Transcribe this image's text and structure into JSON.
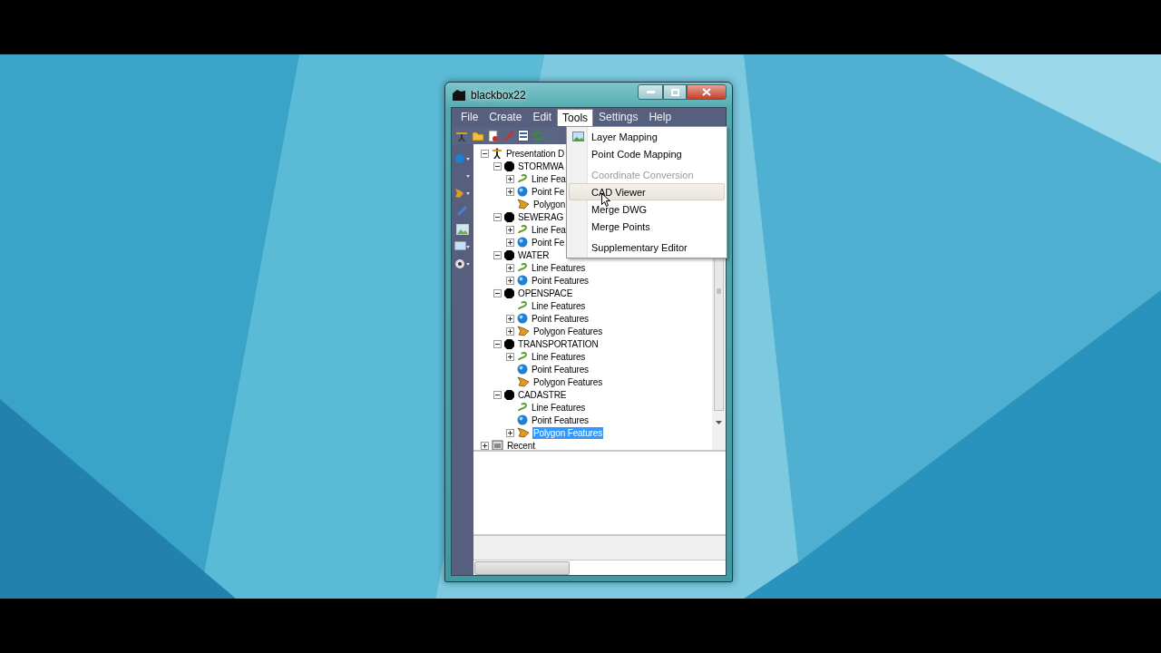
{
  "window": {
    "title": "blackbox22"
  },
  "menu_bar": [
    {
      "label": "File",
      "selected": false
    },
    {
      "label": "Create",
      "selected": false
    },
    {
      "label": "Edit",
      "selected": false
    },
    {
      "label": "Tools",
      "selected": true
    },
    {
      "label": "Settings",
      "selected": false
    },
    {
      "label": "Help",
      "selected": false
    }
  ],
  "tools_menu": [
    {
      "kind": "item",
      "label": "Layer Mapping",
      "icon": true,
      "disabled": false,
      "highlighted": false
    },
    {
      "kind": "item",
      "label": "Point Code Mapping",
      "icon": false,
      "disabled": false,
      "highlighted": false
    },
    {
      "kind": "separator"
    },
    {
      "kind": "item",
      "label": "Coordinate Conversion",
      "icon": false,
      "disabled": true,
      "highlighted": false
    },
    {
      "kind": "item",
      "label": "CAD Viewer",
      "icon": false,
      "disabled": false,
      "highlighted": true
    },
    {
      "kind": "item",
      "label": "Merge DWG",
      "icon": false,
      "disabled": false,
      "highlighted": false
    },
    {
      "kind": "item",
      "label": "Merge Points",
      "icon": false,
      "disabled": false,
      "highlighted": false
    },
    {
      "kind": "separator"
    },
    {
      "kind": "item",
      "label": "Supplementary Editor",
      "icon": false,
      "disabled": false,
      "highlighted": false
    }
  ],
  "tree": [
    {
      "label": "Presentation D",
      "kind": "root",
      "expanded": true,
      "selected": false,
      "children": [
        {
          "label": "STORMWA",
          "kind": "group",
          "expanded": true,
          "selected": false,
          "children": [
            {
              "label": "Line Fea",
              "kind": "line",
              "expanded": false,
              "selected": false
            },
            {
              "label": "Point Fe",
              "kind": "point",
              "expanded": false,
              "selected": false
            },
            {
              "label": "Polygon",
              "kind": "polygon",
              "selected": false
            }
          ]
        },
        {
          "label": "SEWERAG",
          "kind": "group",
          "expanded": true,
          "selected": false,
          "children": [
            {
              "label": "Line Fea",
              "kind": "line",
              "expanded": false,
              "selected": false
            },
            {
              "label": "Point Fe",
              "kind": "point",
              "expanded": false,
              "selected": false
            }
          ]
        },
        {
          "label": "WATER",
          "kind": "group",
          "expanded": true,
          "selected": false,
          "children": [
            {
              "label": "Line Features",
              "kind": "line",
              "expanded": false,
              "selected": false
            },
            {
              "label": "Point Features",
              "kind": "point",
              "expanded": false,
              "selected": false
            }
          ]
        },
        {
          "label": "OPENSPACE",
          "kind": "group",
          "expanded": true,
          "selected": false,
          "children": [
            {
              "label": "Line Features",
              "kind": "line",
              "selected": false
            },
            {
              "label": "Point Features",
              "kind": "point",
              "expanded": false,
              "selected": false
            },
            {
              "label": "Polygon Features",
              "kind": "polygon",
              "expanded": false,
              "selected": false
            }
          ]
        },
        {
          "label": "TRANSPORTATION",
          "kind": "group",
          "expanded": true,
          "selected": false,
          "children": [
            {
              "label": "Line Features",
              "kind": "line",
              "expanded": false,
              "selected": false
            },
            {
              "label": "Point Features",
              "kind": "point",
              "selected": false
            },
            {
              "label": "Polygon Features",
              "kind": "polygon",
              "selected": false
            }
          ]
        },
        {
          "label": "CADASTRE",
          "kind": "group",
          "expanded": true,
          "selected": false,
          "children": [
            {
              "label": "Line Features",
              "kind": "line",
              "selected": false
            },
            {
              "label": "Point Features",
              "kind": "point",
              "selected": false
            },
            {
              "label": "Polygon Features",
              "kind": "polygon",
              "expanded": false,
              "selected": true
            }
          ]
        }
      ]
    },
    {
      "label": "Recent",
      "kind": "recent",
      "expanded": false,
      "selected": false
    }
  ]
}
